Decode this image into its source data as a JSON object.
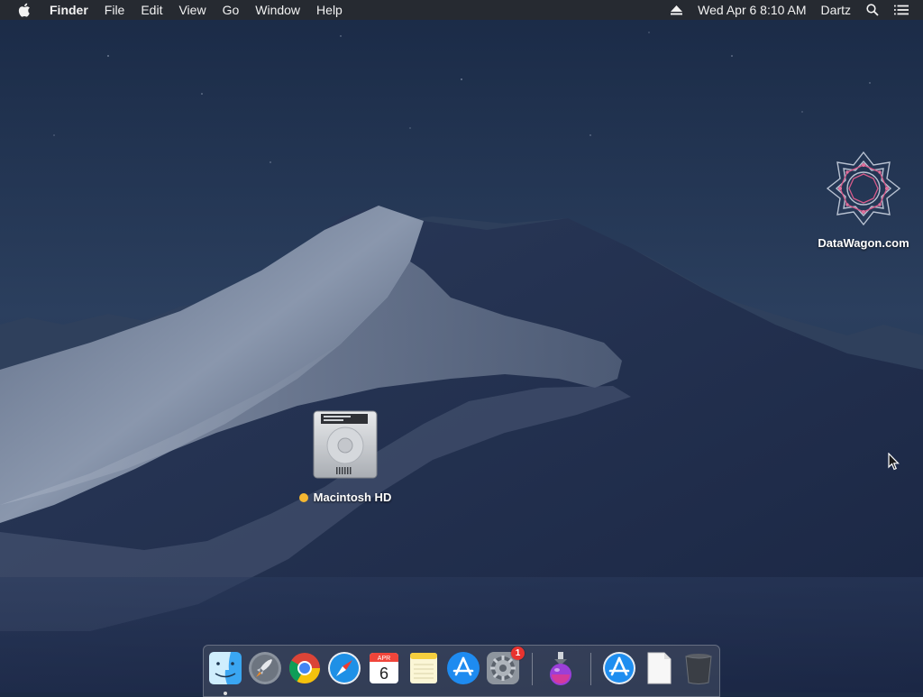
{
  "menubar": {
    "apple_icon": "apple-logo-icon",
    "app_name": "Finder",
    "menus": [
      "File",
      "Edit",
      "View",
      "Go",
      "Window",
      "Help"
    ],
    "eject_icon": "eject-icon",
    "clock": "Wed Apr 6  8:10 AM",
    "user": "Dartz",
    "search_icon": "spotlight-search-icon",
    "notifications_icon": "notification-center-icon"
  },
  "desktop": {
    "wallpaper": "macOS Mojave dark desert dunes",
    "icons": [
      {
        "name": "Macintosh HD",
        "icon": "hard-drive-icon",
        "tag_color": "#f5b731"
      },
      {
        "name": "DataWagon.com",
        "icon": "datawagon-logo-icon"
      }
    ]
  },
  "dock": {
    "items": [
      {
        "app": "Finder",
        "icon": "finder-icon",
        "running": true
      },
      {
        "app": "Launchpad",
        "icon": "launchpad-rocket-icon"
      },
      {
        "app": "Google Chrome",
        "icon": "chrome-icon"
      },
      {
        "app": "Safari",
        "icon": "safari-compass-icon"
      },
      {
        "app": "Calendar",
        "icon": "calendar-icon",
        "month": "APR",
        "day": "6"
      },
      {
        "app": "Notes",
        "icon": "notes-icon"
      },
      {
        "app": "App Store",
        "icon": "app-store-icon"
      },
      {
        "app": "System Preferences",
        "icon": "system-preferences-gear-icon",
        "badge": "1"
      },
      {
        "app": "Installer",
        "icon": "installer-potion-icon"
      },
      {
        "app": "App Store folder",
        "icon": "app-store-folder-icon"
      },
      {
        "app": "Document",
        "icon": "blank-document-icon"
      },
      {
        "app": "Trash",
        "icon": "trash-icon"
      }
    ]
  },
  "colors": {
    "menubar_bg": "#262a31",
    "sky_top": "#1a2a46",
    "sky_mid": "#2d4261",
    "dune_light": "#8a97ad",
    "dune_dark": "#1f2c49",
    "tag_orange": "#f5b731",
    "badge_red": "#e8332f"
  }
}
